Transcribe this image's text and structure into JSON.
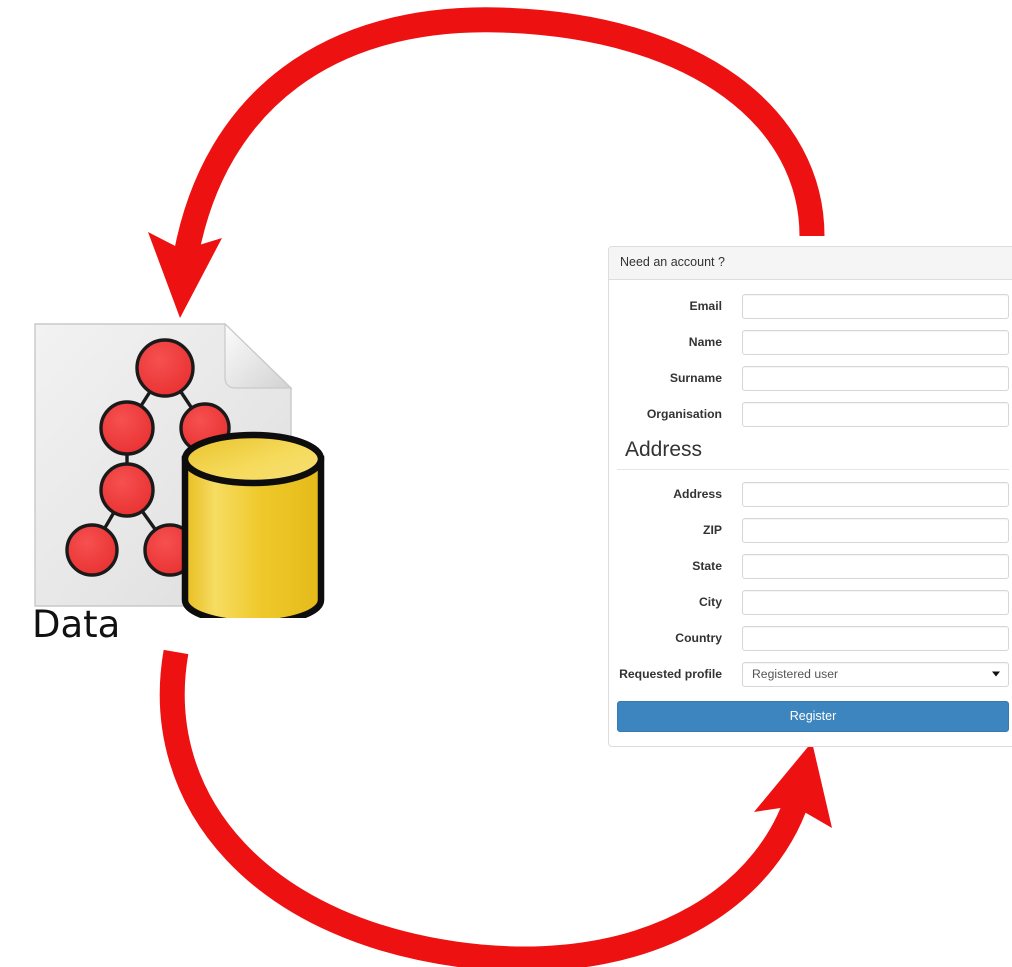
{
  "diagram": {
    "title_caption": "Data",
    "arrow_color": "#ee1111",
    "arrows": [
      {
        "name": "data-to-form-arrow",
        "direction": "down-left",
        "description": "curved red arrow from registration form area to data store"
      },
      {
        "name": "form-to-data-arrow",
        "direction": "up-right",
        "description": "curved red arrow from data store to registration form"
      }
    ],
    "data_icon": {
      "document_color": "#e9e9e9",
      "node_color": "#ef3b3b",
      "database_color": "#f0cb2e",
      "tree_node_count": 6
    }
  },
  "form": {
    "panel_title": "Need an account ?",
    "fields": [
      {
        "label": "Email",
        "value": "",
        "placeholder": "",
        "type": "text"
      },
      {
        "label": "Name",
        "value": "",
        "placeholder": "",
        "type": "text"
      },
      {
        "label": "Surname",
        "value": "",
        "placeholder": "",
        "type": "text"
      },
      {
        "label": "Organisation",
        "value": "",
        "placeholder": "",
        "type": "text"
      }
    ],
    "address_section": {
      "legend": "Address",
      "fields": [
        {
          "label": "Address",
          "value": "",
          "placeholder": "",
          "type": "text"
        },
        {
          "label": "ZIP",
          "value": "",
          "placeholder": "",
          "type": "text"
        },
        {
          "label": "State",
          "value": "",
          "placeholder": "",
          "type": "text"
        },
        {
          "label": "City",
          "value": "",
          "placeholder": "",
          "type": "text"
        },
        {
          "label": "Country",
          "value": "",
          "placeholder": "",
          "type": "text"
        }
      ]
    },
    "profile": {
      "label": "Requested profile",
      "selected": "Registered user",
      "caret_icon": "chevron-down-icon"
    },
    "submit_label": "Register",
    "submit_color": "#3d85be"
  }
}
